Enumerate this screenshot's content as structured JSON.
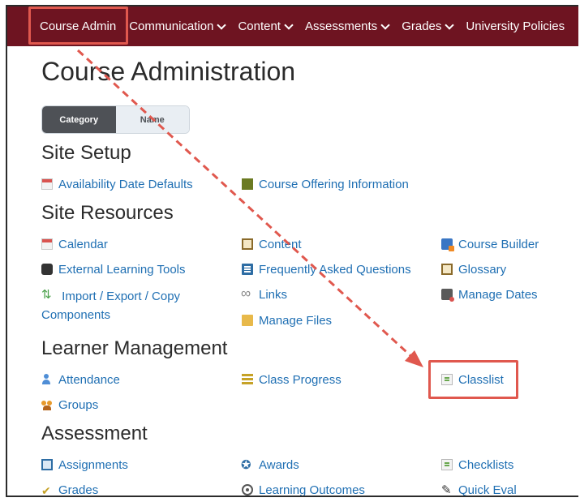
{
  "navbar": {
    "items": [
      {
        "label": "Course Admin",
        "dropdown": false
      },
      {
        "label": "Communication",
        "dropdown": true
      },
      {
        "label": "Content",
        "dropdown": true
      },
      {
        "label": "Assessments",
        "dropdown": true
      },
      {
        "label": "Grades",
        "dropdown": true
      },
      {
        "label": "University Policies",
        "dropdown": false
      }
    ],
    "background": "#6e1421"
  },
  "page": {
    "title": "Course Administration"
  },
  "view_toggle": {
    "category_label": "Category",
    "name_label": "Name",
    "selected": "Category"
  },
  "sections": {
    "site_setup": {
      "title": "Site Setup",
      "links": [
        "Availability Date Defaults",
        "Course Offering Information"
      ]
    },
    "site_resources": {
      "title": "Site Resources",
      "links": [
        "Calendar",
        "Content",
        "Course Builder",
        "External Learning Tools",
        "Frequently Asked Questions",
        "Glossary",
        "Import / Export / Copy Components",
        "Links",
        "Manage Dates",
        "Manage Files"
      ]
    },
    "learner_management": {
      "title": "Learner Management",
      "links": [
        "Attendance",
        "Class Progress",
        "Classlist",
        "Groups"
      ]
    },
    "assessment": {
      "title": "Assessment",
      "links": [
        "Assignments",
        "Awards",
        "Checklists",
        "Grades",
        "Learning Outcomes",
        "Quick Eval"
      ]
    }
  },
  "annotation": {
    "color": "#e0584e",
    "highlighted": [
      "Course Admin",
      "Classlist"
    ]
  },
  "link_color": "#1f6fb3"
}
